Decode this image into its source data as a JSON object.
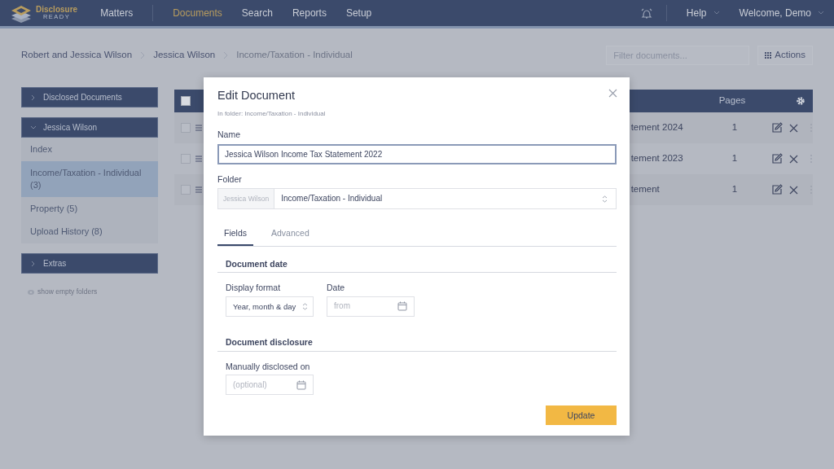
{
  "navbar": {
    "logo": {
      "title": "Disclosure",
      "subtitle": "READY"
    },
    "items": [
      {
        "label": "Matters",
        "selected": false
      },
      {
        "label": "Documents",
        "selected": true
      },
      {
        "label": "Search",
        "selected": false
      },
      {
        "label": "Reports",
        "selected": false
      },
      {
        "label": "Setup",
        "selected": false
      }
    ],
    "help": "Help",
    "user": "Welcome, Demo"
  },
  "breadcrumb": [
    "Robert and Jessica Wilson",
    "Jessica Wilson",
    "Income/Taxation - Individual"
  ],
  "filter": {
    "placeholder": "Filter documents..."
  },
  "actions_button": "Actions",
  "sidebar": {
    "sections": [
      {
        "title": "Disclosed Documents",
        "expanded": false
      },
      {
        "title": "Jessica Wilson",
        "expanded": true,
        "items": [
          {
            "label": "Index",
            "selected": false
          },
          {
            "label": "Income/Taxation - Individual (3)",
            "selected": true
          },
          {
            "label": "Property (5)",
            "selected": false
          },
          {
            "label": "Upload History (8)",
            "selected": false
          }
        ]
      },
      {
        "title": "Extras",
        "expanded": false
      }
    ],
    "show_empty": "show empty folders"
  },
  "table": {
    "select_all_checked": false,
    "pages_column": "Pages",
    "rows": [
      {
        "checked": false,
        "name": "tement 2024",
        "pages": "1"
      },
      {
        "checked": false,
        "name": "tement 2023",
        "pages": "1"
      },
      {
        "checked": false,
        "name": "tement",
        "pages": "1"
      }
    ]
  },
  "modal": {
    "title": "Edit Document",
    "subtitle": "In folder: Income/Taxation - Individual",
    "name_label": "Name",
    "name_value": "Jessica Wilson Income Tax Statement 2022",
    "folder_label": "Folder",
    "folder_prefix": "Jessica Wilson",
    "folder_value": "Income/Taxation - Individual",
    "tabs": [
      {
        "label": "Fields",
        "selected": true
      },
      {
        "label": "Advanced",
        "selected": false
      }
    ],
    "date_section": "Document date",
    "format_label": "Display format",
    "format_value": "Year, month & day",
    "date_label": "Date",
    "date_placeholder": "from",
    "disclosure_section": "Document disclosure",
    "disclosed_label": "Manually disclosed on",
    "disclosed_placeholder": "(optional)",
    "update_button": "Update"
  }
}
